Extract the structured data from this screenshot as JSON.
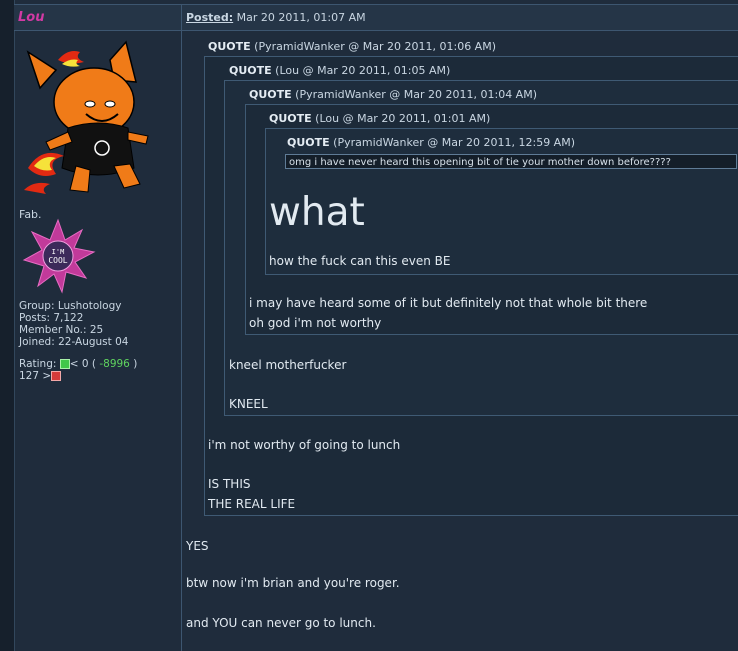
{
  "header": {
    "username": "Lou",
    "posted_label": "Posted:",
    "posted_date": "Mar 20 2011, 01:07 AM"
  },
  "profile": {
    "signature_text": "Fab.",
    "badge_text": "I'M COOL",
    "group": "Group: Lushotology",
    "posts": "Posts: 7,122",
    "member_no": "Member No.: 25",
    "joined": "Joined: 22-August 04",
    "rating_label": "Rating:",
    "rating_lt": "< 0 (",
    "rating_value": "-8996",
    "rating_close": ")",
    "rating_line2": "127 >"
  },
  "quotes": [
    {
      "label": "QUOTE",
      "meta": "(PyramidWanker @ Mar 20 2011, 01:06 AM)"
    },
    {
      "label": "QUOTE",
      "meta": "(Lou @ Mar 20 2011, 01:05 AM)"
    },
    {
      "label": "QUOTE",
      "meta": "(PyramidWanker @ Mar 20 2011, 01:04 AM)"
    },
    {
      "label": "QUOTE",
      "meta": "(Lou @ Mar 20 2011, 01:01 AM)"
    },
    {
      "label": "QUOTE",
      "meta": "(PyramidWanker @ Mar 20 2011, 12:59 AM)"
    }
  ],
  "content": {
    "innermost": "omg i have never heard this opening bit of tie your mother down before????",
    "big_what": "what",
    "how_line": "how the fuck can this even BE",
    "heard_1": "i may have heard some of it but definitely not that whole bit there",
    "heard_2": "oh god i'm not worthy",
    "kneel_1": "kneel motherfucker",
    "kneel_2": "KNEEL",
    "lunch": "i'm not worthy of going to lunch",
    "is_this": "IS THIS",
    "real_life": "THE REAL LIFE",
    "yes": "YES",
    "brian": "btw now i'm brian and you're roger.",
    "you_lunch": "and YOU can never go to lunch."
  },
  "colors": {
    "background": "#1f2c3c",
    "username": "#d23aa4",
    "rating_negative": "#5fd35f"
  }
}
